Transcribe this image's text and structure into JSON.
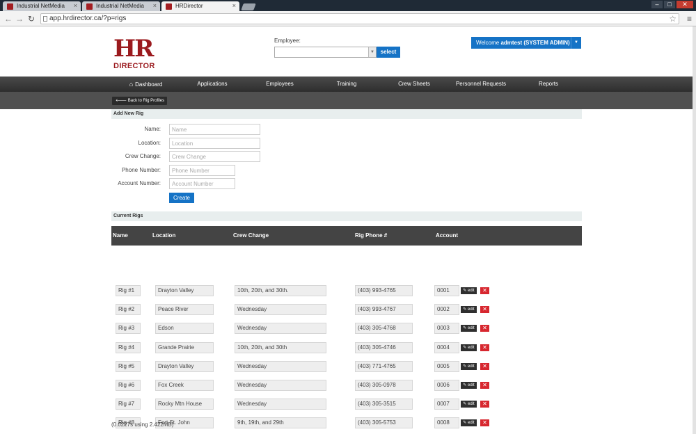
{
  "browser": {
    "tabs": [
      {
        "title": "Industrial NetMedia",
        "active": false
      },
      {
        "title": "Industrial NetMedia",
        "active": false
      },
      {
        "title": "HRDirector",
        "active": true
      }
    ],
    "url": "app.hrdirector.ca/?p=rigs"
  },
  "brand": {
    "logo_top": "HR",
    "logo_bottom": "DIRECTOR",
    "color": "#9b1a1e"
  },
  "employee_picker": {
    "label": "Employee:",
    "button": "select"
  },
  "user_menu": {
    "prefix": "Welcome",
    "user": "admtest (SYSTEM ADMIN)"
  },
  "nav": {
    "items": [
      "Dashboard",
      "Applications",
      "Employees",
      "Training",
      "Crew Sheets",
      "Personnel Requests",
      "Reports"
    ]
  },
  "back_button": "Back to Rig Profiles",
  "add_form": {
    "heading": "Add New Rig",
    "fields": [
      {
        "label": "Name:",
        "placeholder": "Name"
      },
      {
        "label": "Location:",
        "placeholder": "Location"
      },
      {
        "label": "Crew Change:",
        "placeholder": "Crew Change"
      },
      {
        "label": "Phone Number:",
        "placeholder": "Phone Number"
      },
      {
        "label": "Account Number:",
        "placeholder": "Account Number"
      }
    ],
    "submit": "Create"
  },
  "rigs": {
    "heading": "Current Rigs",
    "columns": [
      "Name",
      "Location",
      "Crew Change",
      "Rig Phone #",
      "Account"
    ],
    "edit_label": "edit",
    "delete_label": "✕",
    "rows": [
      {
        "name": "Rig #1",
        "location": "Drayton Valley",
        "crew_change": "10th, 20th, and 30th.",
        "phone": "(403) 993-4765",
        "account": "0001"
      },
      {
        "name": "Rig #2",
        "location": "Peace River",
        "crew_change": "Wednesday",
        "phone": "(403) 993-4767",
        "account": "0002"
      },
      {
        "name": "Rig #3",
        "location": "Edson",
        "crew_change": "Wednesday",
        "phone": "(403) 305-4768",
        "account": "0003"
      },
      {
        "name": "Rig #4",
        "location": "Grande Prairie",
        "crew_change": "10th, 20th, and 30th",
        "phone": "(403) 305-4746",
        "account": "0004"
      },
      {
        "name": "Rig #5",
        "location": "Drayton Valley",
        "crew_change": "Wednesday",
        "phone": "(403) 771-4765",
        "account": "0005"
      },
      {
        "name": "Rig #6",
        "location": "Fox Creek",
        "crew_change": "Wednesday",
        "phone": "(403) 305-0978",
        "account": "0006"
      },
      {
        "name": "Rig #7",
        "location": "Rocky Mtn House",
        "crew_change": "Wednesday",
        "phone": "(403) 305-3515",
        "account": "0007"
      },
      {
        "name": "Rig #8",
        "location": "Fort St. John",
        "crew_change": "9th, 19th, and 29th",
        "phone": "(403) 305-5753",
        "account": "0008"
      }
    ]
  },
  "footer": "(0.0227s using 2.422MB)",
  "colors": {
    "primary_blue": "#1573c6",
    "nav_dark": "#3a3a3a",
    "delete_red": "#d7272f"
  }
}
